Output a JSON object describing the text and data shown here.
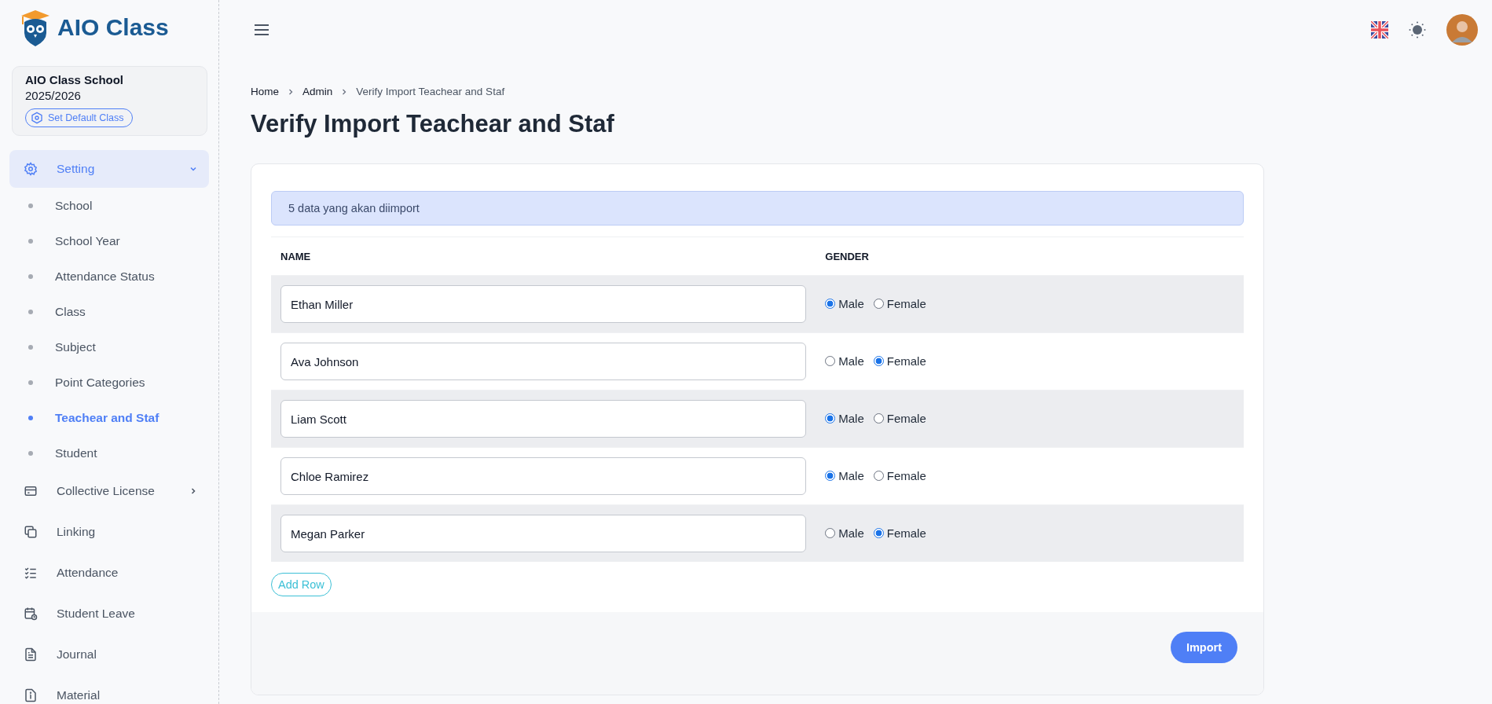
{
  "sidebar": {
    "logo": {
      "text": "AIO Class"
    },
    "school_card": {
      "name": "AIO Class School",
      "year": "2025/2026",
      "button": "Set Default Class"
    },
    "menu": [
      {
        "label": "Setting",
        "expanded": true,
        "children": [
          {
            "label": "School",
            "selected": false
          },
          {
            "label": "School Year",
            "selected": false
          },
          {
            "label": "Attendance Status",
            "selected": false
          },
          {
            "label": "Class",
            "selected": false
          },
          {
            "label": "Subject",
            "selected": false
          },
          {
            "label": "Point Categories",
            "selected": false
          },
          {
            "label": "Teachear and Staf",
            "selected": true
          },
          {
            "label": "Student",
            "selected": false
          }
        ]
      },
      {
        "label": "Collective License",
        "expanded": false
      },
      {
        "label": "Linking"
      },
      {
        "label": "Attendance"
      },
      {
        "label": "Student Leave"
      },
      {
        "label": "Journal"
      },
      {
        "label": "Material"
      }
    ]
  },
  "breadcrumb": [
    "Home",
    "Admin",
    "Verify Import Teachear and Staf"
  ],
  "title": "Verify Import Teachear and Staf",
  "alert": "5 data yang akan diimport",
  "table": {
    "columns": [
      "NAME",
      "GENDER"
    ],
    "rows": [
      {
        "name": "Ethan Miller",
        "gender": [
          {
            "label": "Male",
            "selected": true
          },
          {
            "label": "Female",
            "selected": false
          }
        ]
      },
      {
        "name": "Ava Johnson",
        "gender": [
          {
            "label": "Male",
            "selected": false
          },
          {
            "label": "Female",
            "selected": true
          }
        ]
      },
      {
        "name": "Liam Scott",
        "gender": [
          {
            "label": "Male",
            "selected": true
          },
          {
            "label": "Female",
            "selected": false
          }
        ]
      },
      {
        "name": "Chloe Ramirez",
        "gender": [
          {
            "label": "Male",
            "selected": true
          },
          {
            "label": "Female",
            "selected": false
          }
        ]
      },
      {
        "name": "Megan Parker",
        "gender": [
          {
            "label": "Male",
            "selected": false
          },
          {
            "label": "Female",
            "selected": true
          }
        ]
      }
    ]
  },
  "add_row_button": "Add Row",
  "import_button": "Import"
}
